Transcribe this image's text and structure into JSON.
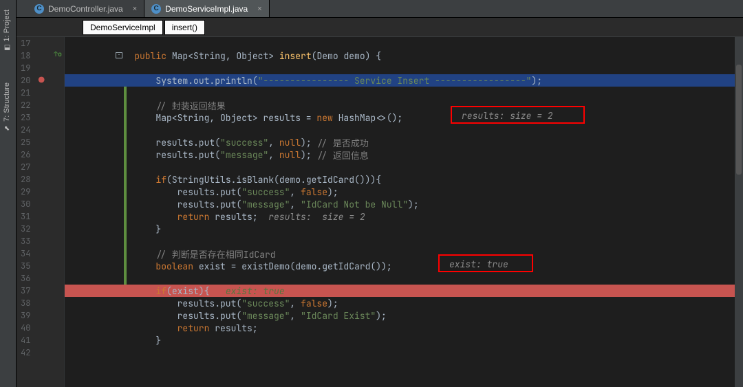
{
  "sidebar": {
    "tools": [
      {
        "label": "1: Project",
        "icon": "⬒"
      },
      {
        "label": "7: Structure",
        "icon": "⬈"
      }
    ]
  },
  "tabs": [
    {
      "label": "DemoController.java",
      "active": false
    },
    {
      "label": "DemoServiceImpl.java",
      "active": true
    }
  ],
  "breadcrumbs": [
    "DemoServiceImpl",
    "insert()"
  ],
  "lines": {
    "17": "",
    "18": [
      {
        "t": "    ",
        "cls": ""
      },
      {
        "t": "public",
        "cls": "k"
      },
      {
        "t": " Map<String, Object> ",
        "cls": "p"
      },
      {
        "t": "insert",
        "cls": "fn"
      },
      {
        "t": "(Demo ",
        "cls": "p"
      },
      {
        "t": "demo",
        "cls": "p"
      },
      {
        "t": ") {",
        "cls": "p"
      }
    ],
    "19": "",
    "20": [
      {
        "t": "        System.",
        "cls": "p"
      },
      {
        "t": "out",
        "cls": "p"
      },
      {
        "t": ".println(",
        "cls": "p"
      },
      {
        "t": "\"---------------- Service Insert -----------------\"",
        "cls": "s"
      },
      {
        "t": ");",
        "cls": "p"
      }
    ],
    "21": "",
    "22": [
      {
        "t": "        ",
        "cls": ""
      },
      {
        "t": "// 封装返回结果",
        "cls": "c"
      }
    ],
    "23": [
      {
        "t": "        Map<String, Object> results = ",
        "cls": "p"
      },
      {
        "t": "new",
        "cls": "k"
      },
      {
        "t": " HashMap<>();  ",
        "cls": "p"
      }
    ],
    "24": "",
    "25": [
      {
        "t": "        results.put(",
        "cls": "p"
      },
      {
        "t": "\"success\"",
        "cls": "s"
      },
      {
        "t": ", ",
        "cls": "p"
      },
      {
        "t": "null",
        "cls": "k"
      },
      {
        "t": "); ",
        "cls": "p"
      },
      {
        "t": "// 是否成功",
        "cls": "c"
      }
    ],
    "26": [
      {
        "t": "        results.put(",
        "cls": "p"
      },
      {
        "t": "\"message\"",
        "cls": "s"
      },
      {
        "t": ", ",
        "cls": "p"
      },
      {
        "t": "null",
        "cls": "k"
      },
      {
        "t": "); ",
        "cls": "p"
      },
      {
        "t": "// 返回信息",
        "cls": "c"
      }
    ],
    "27": "",
    "28": [
      {
        "t": "        ",
        "cls": ""
      },
      {
        "t": "if",
        "cls": "k"
      },
      {
        "t": "(StringUtils.",
        "cls": "p"
      },
      {
        "t": "isBlank",
        "cls": "p"
      },
      {
        "t": "(demo.getIdCard())){",
        "cls": "p"
      }
    ],
    "29": [
      {
        "t": "            results.put(",
        "cls": "p"
      },
      {
        "t": "\"success\"",
        "cls": "s"
      },
      {
        "t": ", ",
        "cls": "p"
      },
      {
        "t": "false",
        "cls": "k"
      },
      {
        "t": ");",
        "cls": "p"
      }
    ],
    "30": [
      {
        "t": "            results.put(",
        "cls": "p"
      },
      {
        "t": "\"message\"",
        "cls": "s"
      },
      {
        "t": ", ",
        "cls": "p"
      },
      {
        "t": "\"IdCard Not be Null\"",
        "cls": "s"
      },
      {
        "t": ");",
        "cls": "p"
      }
    ],
    "31": [
      {
        "t": "            ",
        "cls": ""
      },
      {
        "t": "return",
        "cls": "k"
      },
      {
        "t": " results;  ",
        "cls": "p"
      },
      {
        "t": "results:  size = 2",
        "cls": "hint"
      }
    ],
    "32": [
      {
        "t": "        }",
        "cls": "p"
      }
    ],
    "33": "",
    "34": [
      {
        "t": "        ",
        "cls": ""
      },
      {
        "t": "// 判断是否存在相同IdCard",
        "cls": "c"
      }
    ],
    "35": [
      {
        "t": "        ",
        "cls": ""
      },
      {
        "t": "boolean",
        "cls": "k"
      },
      {
        "t": " exist = existDemo(demo.getIdCard());  ",
        "cls": "p"
      }
    ],
    "36": "",
    "37": [
      {
        "t": "        ",
        "cls": ""
      },
      {
        "t": "if",
        "cls": "k"
      },
      {
        "t": "(exist){   ",
        "cls": "p"
      },
      {
        "t": "exist: true",
        "cls": "hint-g"
      }
    ],
    "38": [
      {
        "t": "            results.put(",
        "cls": "p"
      },
      {
        "t": "\"success\"",
        "cls": "s"
      },
      {
        "t": ", ",
        "cls": "p"
      },
      {
        "t": "false",
        "cls": "k"
      },
      {
        "t": ");",
        "cls": "p"
      }
    ],
    "39": [
      {
        "t": "            results.put(",
        "cls": "p"
      },
      {
        "t": "\"message\"",
        "cls": "s"
      },
      {
        "t": ", ",
        "cls": "p"
      },
      {
        "t": "\"IdCard Exist\"",
        "cls": "s"
      },
      {
        "t": ");",
        "cls": "p"
      }
    ],
    "40": [
      {
        "t": "            ",
        "cls": ""
      },
      {
        "t": "return",
        "cls": "k"
      },
      {
        "t": " results;",
        "cls": "p"
      }
    ],
    "41": [
      {
        "t": "        }",
        "cls": "p"
      }
    ],
    "42": ""
  },
  "hints": {
    "line23": "results:  size = 2",
    "line35": "exist: true"
  },
  "gutter_icons": {
    "override18": "↑o",
    "breakpoint20": "●"
  },
  "line_start": 17,
  "line_end": 42
}
